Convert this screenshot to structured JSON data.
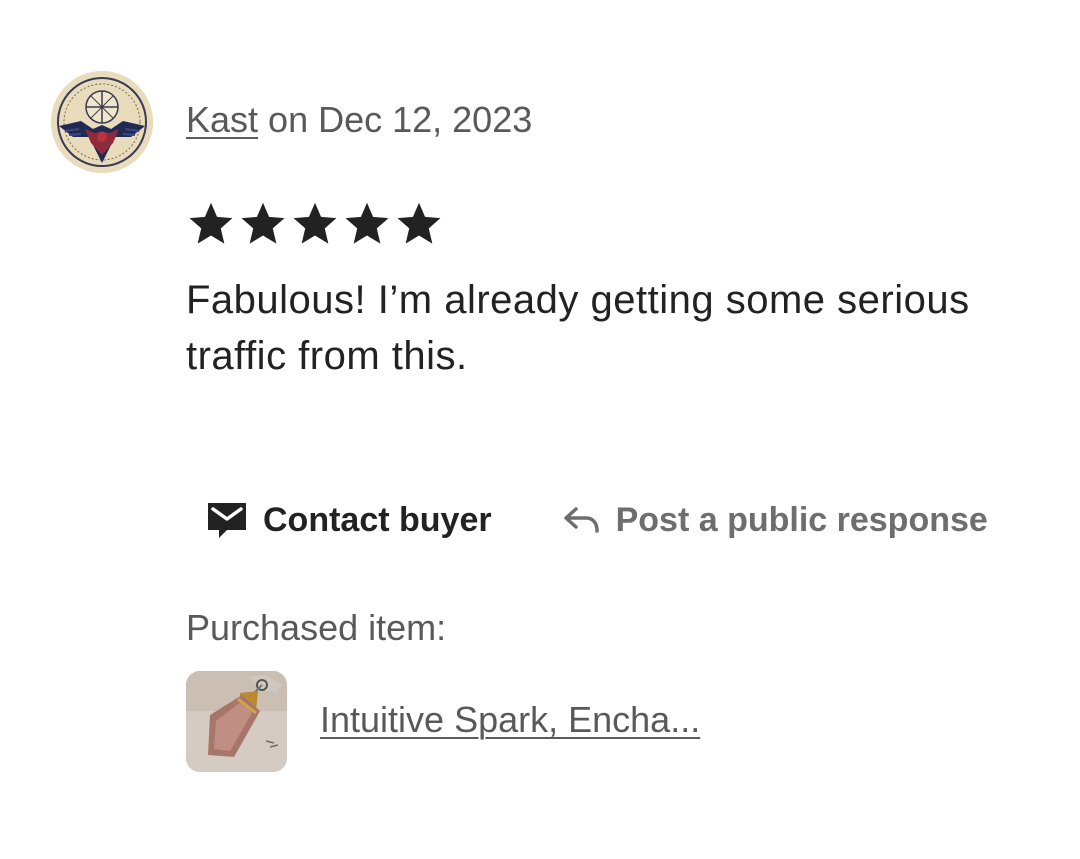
{
  "review": {
    "reviewer_name": "Kast",
    "date_text": " on Dec 12, 2023",
    "rating": 5,
    "rating_max": 5,
    "text": "Fabulous! I’m already getting some serious traffic from this."
  },
  "actions": {
    "contact_label": "Contact buyer",
    "contact_icon": "envelope-icon",
    "response_label": "Post a public response",
    "response_icon": "reply-arrow-icon"
  },
  "purchase": {
    "label": "Purchased item:",
    "item_title": "Intuitive Spark, Encha..."
  },
  "colors": {
    "text_primary": "#222222",
    "text_secondary": "#595959",
    "text_muted": "#6e6e6e",
    "background": "#ffffff"
  }
}
